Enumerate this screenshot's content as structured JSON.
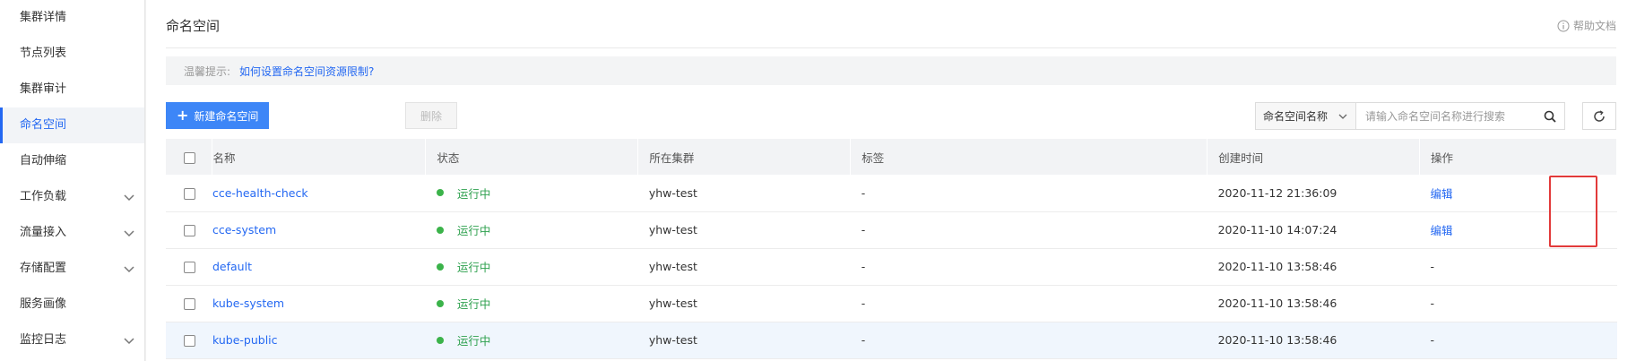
{
  "sidebar": {
    "items": [
      {
        "label": "集群详情",
        "active": false,
        "expandable": false
      },
      {
        "label": "节点列表",
        "active": false,
        "expandable": false
      },
      {
        "label": "集群审计",
        "active": false,
        "expandable": false
      },
      {
        "label": "命名空间",
        "active": true,
        "expandable": false
      },
      {
        "label": "自动伸缩",
        "active": false,
        "expandable": false
      },
      {
        "label": "工作负载",
        "active": false,
        "expandable": true
      },
      {
        "label": "流量接入",
        "active": false,
        "expandable": true
      },
      {
        "label": "存储配置",
        "active": false,
        "expandable": true
      },
      {
        "label": "服务画像",
        "active": false,
        "expandable": false
      },
      {
        "label": "监控日志",
        "active": false,
        "expandable": true
      }
    ]
  },
  "header": {
    "title": "命名空间",
    "help_label": "帮助文档"
  },
  "tip": {
    "label": "温馨提示:",
    "link": "如何设置命名空间资源限制?"
  },
  "toolbar": {
    "create_label": "新建命名空间",
    "delete_label": "删除",
    "search_field": "命名空间名称",
    "search_placeholder": "请输入命名空间名称进行搜索"
  },
  "table": {
    "columns": [
      "名称",
      "状态",
      "所在集群",
      "标签",
      "创建时间",
      "操作"
    ],
    "rows": [
      {
        "name": "cce-health-check",
        "status": "运行中",
        "cluster": "yhw-test",
        "tags": "-",
        "created": "2020-11-12 21:36:09",
        "op": "编辑"
      },
      {
        "name": "cce-system",
        "status": "运行中",
        "cluster": "yhw-test",
        "tags": "-",
        "created": "2020-11-10 14:07:24",
        "op": "编辑"
      },
      {
        "name": "default",
        "status": "运行中",
        "cluster": "yhw-test",
        "tags": "-",
        "created": "2020-11-10 13:58:46",
        "op": "-"
      },
      {
        "name": "kube-system",
        "status": "运行中",
        "cluster": "yhw-test",
        "tags": "-",
        "created": "2020-11-10 13:58:46",
        "op": "-"
      },
      {
        "name": "kube-public",
        "status": "运行中",
        "cluster": "yhw-test",
        "tags": "-",
        "created": "2020-11-10 13:58:46",
        "op": "-"
      }
    ]
  },
  "colors": {
    "accent": "#2468f2",
    "primary_button": "#3d86f7",
    "status_running": "#3bb34a",
    "highlight_box": "#e23a3a"
  }
}
